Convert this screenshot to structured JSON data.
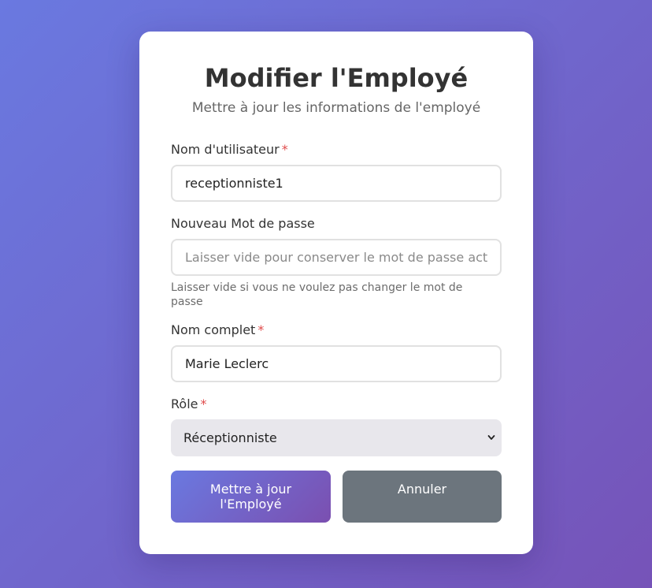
{
  "header": {
    "title": "Modifier l'Employé",
    "subtitle": "Mettre à jour les informations de l'employé"
  },
  "form": {
    "username": {
      "label": "Nom d'utilisateur",
      "required_mark": "*",
      "value": "receptionniste1"
    },
    "password": {
      "label": "Nouveau Mot de passe",
      "placeholder": "Laisser vide pour conserver le mot de passe actuel",
      "help": "Laisser vide si vous ne voulez pas changer le mot de passe"
    },
    "fullname": {
      "label": "Nom complet",
      "required_mark": "*",
      "value": "Marie Leclerc"
    },
    "role": {
      "label": "Rôle",
      "required_mark": "*",
      "selected": "Réceptionniste"
    }
  },
  "actions": {
    "update_label": "Mettre à jour l'Employé",
    "cancel_label": "Annuler"
  },
  "icons": {
    "select_arrow": "chevron-down-icon"
  },
  "colors": {
    "background_gradient_start": "#6a79e0",
    "background_gradient_end": "#7653b8",
    "required": "#e04b4b",
    "cancel_button": "#6c757d"
  }
}
